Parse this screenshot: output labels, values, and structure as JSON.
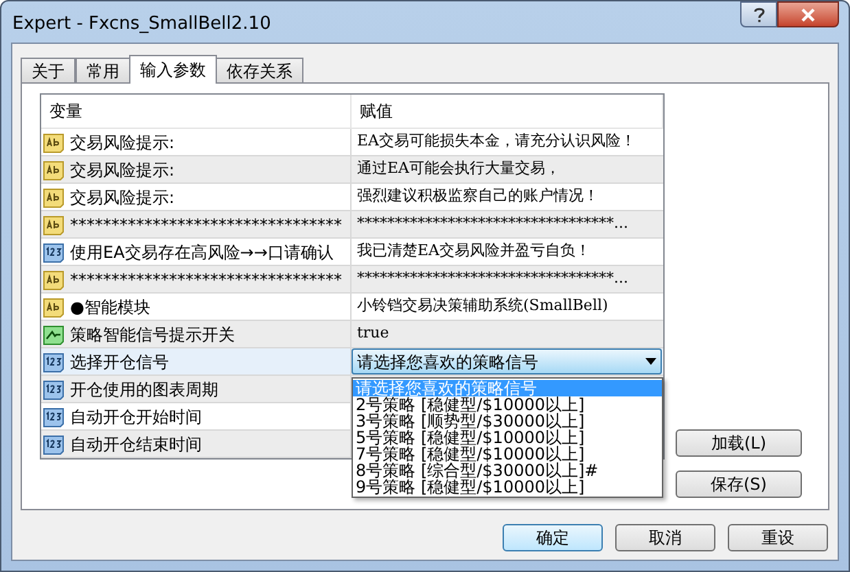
{
  "window": {
    "title": "Expert - Fxcns_SmallBell2.10"
  },
  "tabs": [
    {
      "label": "关于",
      "selected": false
    },
    {
      "label": "常用",
      "selected": false
    },
    {
      "label": "输入参数",
      "selected": true
    },
    {
      "label": "依存关系",
      "selected": false
    }
  ],
  "table": {
    "columns": [
      "变量",
      "赋值"
    ],
    "rows": [
      {
        "kind": "text",
        "name": "交易风险提示:",
        "value": "EA交易可能损失本金，请充分认识风险！",
        "selected": false
      },
      {
        "kind": "text",
        "name": "交易风险提示:",
        "value": "通过EA可能会执行大量交易，",
        "selected": false
      },
      {
        "kind": "text",
        "name": "交易风险提示:",
        "value": "强烈建议积极监察自己的账户情况！",
        "selected": false
      },
      {
        "kind": "text",
        "name": "*********************************",
        "value": "**********************************...",
        "selected": false
      },
      {
        "kind": "number",
        "name": "使用EA交易存在高风险→→口请确认",
        "value": "我已清楚EA交易风险并盈亏自负！",
        "selected": false
      },
      {
        "kind": "text",
        "name": "*********************************",
        "value": "**********************************...",
        "selected": false
      },
      {
        "kind": "text",
        "name": "●智能模块",
        "value": "小铃铛交易决策辅助系统(SmallBell)",
        "selected": false
      },
      {
        "kind": "bool",
        "name": "策略智能信号提示开关",
        "value": "true",
        "selected": false
      },
      {
        "kind": "number",
        "name": "选择开仓信号",
        "combo": "请选择您喜欢的策略信号",
        "selected": true
      },
      {
        "kind": "number",
        "name": "开仓使用的图表周期",
        "selected": false
      },
      {
        "kind": "number",
        "name": "自动开仓开始时间",
        "selected": false
      },
      {
        "kind": "number",
        "name": "自动开仓结束时间",
        "selected": false
      }
    ]
  },
  "dropdown": {
    "items": [
      {
        "label": "请选择您喜欢的策略信号",
        "selected": true
      },
      {
        "label": "2号策略 [稳健型/$10000以上]",
        "selected": false
      },
      {
        "label": "3号策略 [顺势型/$30000以上]",
        "selected": false
      },
      {
        "label": "5号策略 [稳健型/$10000以上]",
        "selected": false
      },
      {
        "label": "7号策略 [稳健型/$10000以上]",
        "selected": false
      },
      {
        "label": "8号策略 [综合型/$30000以上]#",
        "selected": false
      },
      {
        "label": "9号策略 [稳健型/$10000以上]",
        "selected": false
      }
    ]
  },
  "side_buttons": [
    "加载(L)",
    "保存(S)"
  ],
  "buttons": [
    {
      "label": "确定",
      "default": true
    },
    {
      "label": "取消",
      "default": false
    },
    {
      "label": "重设",
      "default": false
    }
  ]
}
